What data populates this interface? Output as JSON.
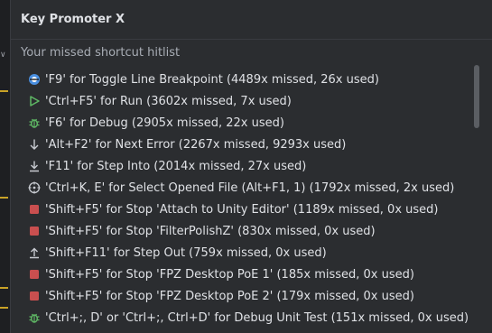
{
  "window": {
    "title": "Key Promoter X"
  },
  "section": {
    "heading": "Your missed shortcut hitlist"
  },
  "colors": {
    "panel": "#2b2d30",
    "green": "#5fb865",
    "red": "#c94f4f",
    "breakpoint": "#4a8fe0"
  },
  "items": [
    {
      "icon": "toggle-breakpoint-icon",
      "text": "'F9' for Toggle Line Breakpoint (4489x missed, 26x used)"
    },
    {
      "icon": "run-icon",
      "text": "'Ctrl+F5' for Run (3602x missed, 7x used)"
    },
    {
      "icon": "debug-icon",
      "text": "'F6' for Debug (2905x missed, 22x used)"
    },
    {
      "icon": "next-error-icon",
      "text": "'Alt+F2' for Next Error (2267x missed, 9293x used)"
    },
    {
      "icon": "step-into-icon",
      "text": "'F11' for Step Into (2014x missed, 27x used)"
    },
    {
      "icon": "select-opened-file-icon",
      "text": "'Ctrl+K, E' for Select Opened File (Alt+F1, 1) (1792x missed, 2x used)"
    },
    {
      "icon": "stop-icon",
      "text": "'Shift+F5' for Stop 'Attach to Unity Editor' (1189x missed, 0x used)"
    },
    {
      "icon": "stop-icon",
      "text": "'Shift+F5' for Stop 'FilterPolishZ' (830x missed, 0x used)"
    },
    {
      "icon": "step-out-icon",
      "text": "'Shift+F11' for Step Out (759x missed, 0x used)"
    },
    {
      "icon": "stop-icon",
      "text": "'Shift+F5' for Stop 'FPZ Desktop PoE 1' (185x missed, 0x used)"
    },
    {
      "icon": "stop-icon",
      "text": "'Shift+F5' for Stop 'FPZ Desktop PoE 2' (179x missed, 0x used)"
    },
    {
      "icon": "debug-unit-test-icon",
      "text": "'Ctrl+;, D' or 'Ctrl+;, Ctrl+D' for Debug Unit Test (151x missed, 0x used)"
    }
  ]
}
